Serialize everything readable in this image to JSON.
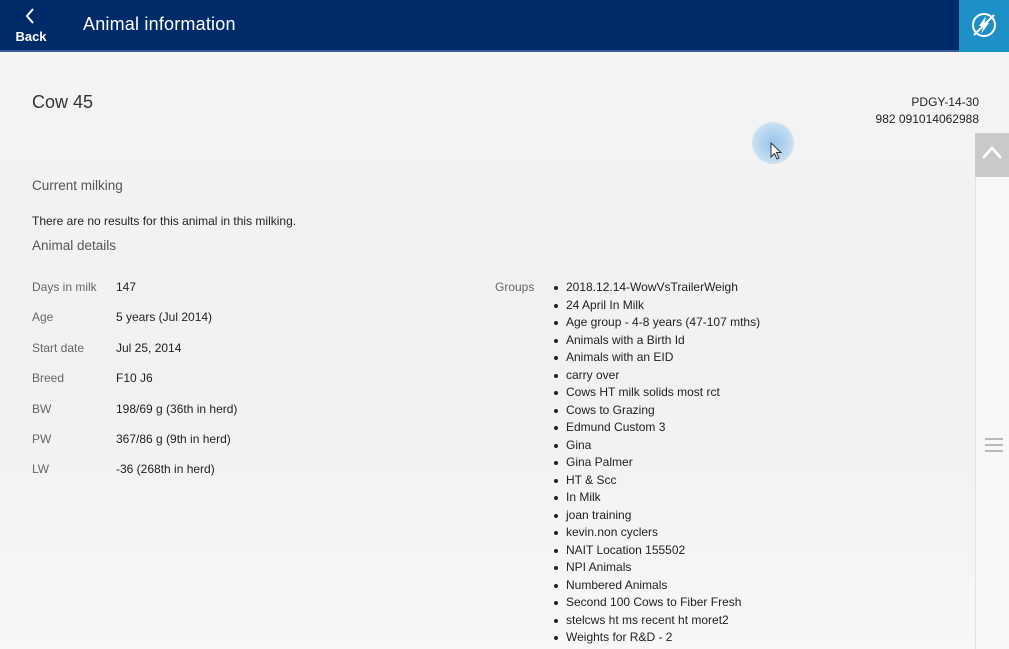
{
  "header": {
    "back_label": "Back",
    "title": "Animal information",
    "action_icon": "lightning-bolt-icon"
  },
  "animal": {
    "name": "Cow 45",
    "id_primary": "PDGY-14-30",
    "id_eid": "982 091014062988"
  },
  "current_milking": {
    "title": "Current milking",
    "message": "There are no results for this animal in this milking."
  },
  "animal_details": {
    "title": "Animal details",
    "rows": [
      {
        "label": "Days in milk",
        "value": "147"
      },
      {
        "label": "Age",
        "value": "5 years (Jul 2014)"
      },
      {
        "label": "Start date",
        "value": "Jul 25, 2014"
      },
      {
        "label": "Breed",
        "value": "F10 J6"
      },
      {
        "label": "BW",
        "value": "198/69 g (36th in herd)"
      },
      {
        "label": "PW",
        "value": "367/86 g (9th in herd)"
      },
      {
        "label": "LW",
        "value": "-36 (268th in herd)"
      }
    ]
  },
  "groups": {
    "label": "Groups",
    "items": [
      "2018.12.14-WowVsTrailerWeigh",
      "24 April In Milk",
      "Age group - 4-8 years (47-107 mths)",
      "Animals with a Birth Id",
      "Animals with an EID",
      "carry over",
      "Cows HT milk solids most rct",
      "Cows to Grazing",
      "Edmund Custom 3",
      "Gina",
      "Gina Palmer",
      "HT & Scc",
      "In Milk",
      "joan training",
      "kevin.non cyclers",
      "NAIT Location 155502",
      "NPI Animals",
      "Numbered Animals",
      "Second 100 Cows to Fiber Fresh",
      "stelcws ht ms recent ht moret2",
      "Weights for R&D - 2"
    ]
  },
  "colors": {
    "header_bg": "#002b6b",
    "action_bg": "#1e90c8"
  }
}
